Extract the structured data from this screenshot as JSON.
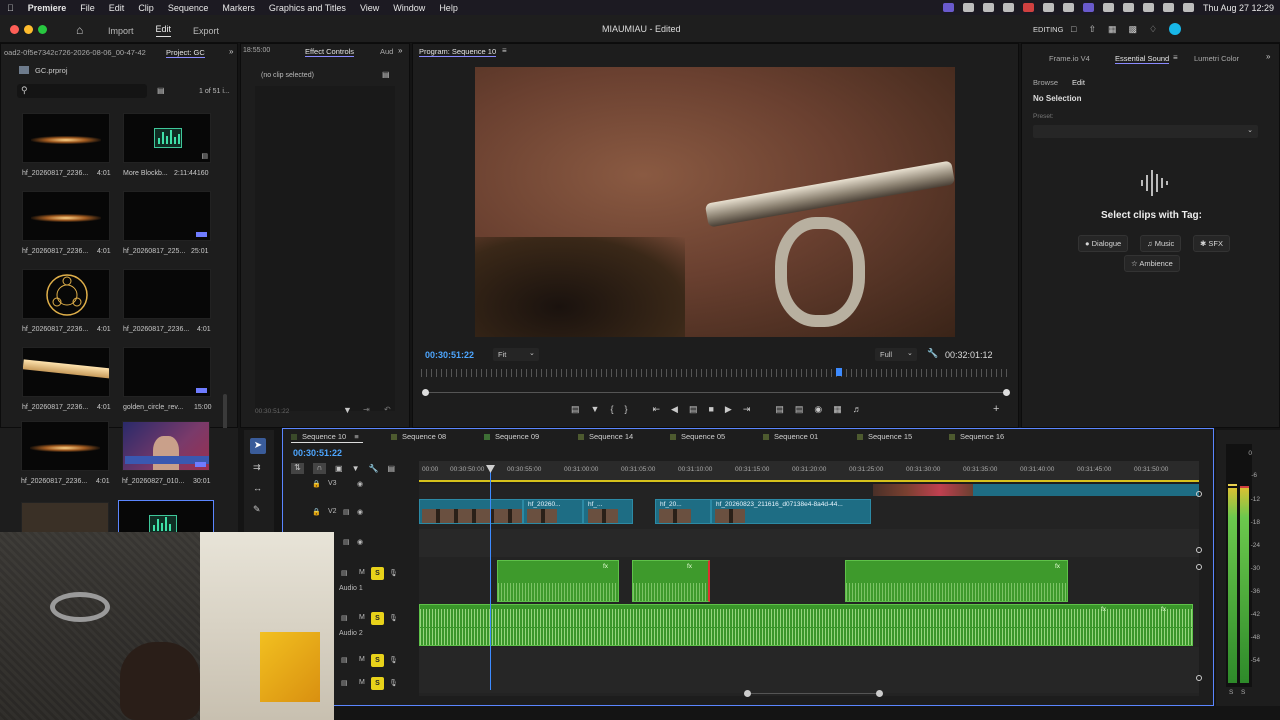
{
  "menubar": {
    "app": "Premiere",
    "items": [
      "File",
      "Edit",
      "Clip",
      "Sequence",
      "Markers",
      "Graphics and Titles",
      "View",
      "Window",
      "Help"
    ],
    "clock": "Thu Aug 27  12:29"
  },
  "header": {
    "nav": {
      "import": "Import",
      "edit": "Edit",
      "export": "Export"
    },
    "title": "MIAUMIAU - Edited",
    "workspace": "EDITING"
  },
  "project": {
    "breadcrumb": "oad2-0f5e7342c726-2026-08-06_00-47-42",
    "tab": "Project: GC",
    "file": "GC.prproj",
    "count": "1 of 51 i...",
    "items": [
      {
        "name": "hf_20260817_2236...",
        "dur": "4:01",
        "type": "flare"
      },
      {
        "name": "More Blockb...",
        "dur": "2:11:44160",
        "type": "audio"
      },
      {
        "name": "hf_20260817_2236...",
        "dur": "4:01",
        "type": "flare"
      },
      {
        "name": "hf_20260817_225...",
        "dur": "25:01",
        "type": "black"
      },
      {
        "name": "hf_20260817_2236...",
        "dur": "4:01",
        "type": "gold"
      },
      {
        "name": "hf_20260817_2236...",
        "dur": "4:01",
        "type": "black"
      },
      {
        "name": "hf_20260817_2236...",
        "dur": "4:01",
        "type": "streak"
      },
      {
        "name": "golden_circle_rev...",
        "dur": "15:00",
        "type": "black"
      },
      {
        "name": "hf_20260817_2236...",
        "dur": "4:01",
        "type": "flare"
      },
      {
        "name": "hf_20260827_010...",
        "dur": "30:01",
        "type": "studio"
      }
    ]
  },
  "effects": {
    "tc_left": "18:55:00",
    "tab": "Effect Controls",
    "tab2": "Aud",
    "no_clip": "(no clip selected)",
    "footer_tc": "00:30:51:22"
  },
  "program": {
    "tab": "Program: Sequence 10",
    "timecode": "00:30:51:22",
    "fit": "Fit",
    "quality": "Full",
    "duration": "00:32:01:12"
  },
  "essential": {
    "tabs": [
      "Frame.io V4",
      "Essential Sound",
      "Lumetri Color"
    ],
    "browse": "Browse",
    "edit": "Edit",
    "no_selection": "No Selection",
    "preset_label": "Preset:",
    "prompt": "Select clips with Tag:",
    "tags": [
      "Dialogue",
      "Music",
      "SFX",
      "Ambience"
    ]
  },
  "timeline": {
    "timecode": "00:30:51:22",
    "tabs": [
      "Sequence 10",
      "Sequence 08",
      "Sequence 09",
      "Sequence 14",
      "Sequence 05",
      "Sequence 01",
      "Sequence 15",
      "Sequence 16"
    ],
    "ruler": [
      "00:00",
      "00:30:50:00",
      "00:30:55:00",
      "00:31:00:00",
      "00:31:05:00",
      "00:31:10:00",
      "00:31:15:00",
      "00:31:20:00",
      "00:31:25:00",
      "00:31:30:00",
      "00:31:35:00",
      "00:31:40:00",
      "00:31:45:00",
      "00:31:50:00"
    ],
    "tracks": {
      "v3": "V3",
      "v2": "V2",
      "a1": "Audio 1",
      "a2": "Audio 2",
      "m": "M",
      "s": "S"
    },
    "clips": [
      "hf_20260...",
      "hf_...",
      "hf_20...",
      "hf_20260823_211616_d07138e4-8a4d-44..."
    ],
    "fx": "fx"
  },
  "meter": {
    "scale": [
      "0",
      "-6",
      "-12",
      "-18",
      "-24",
      "-30",
      "-36",
      "-42",
      "-48",
      "-54"
    ],
    "foot": "S"
  }
}
